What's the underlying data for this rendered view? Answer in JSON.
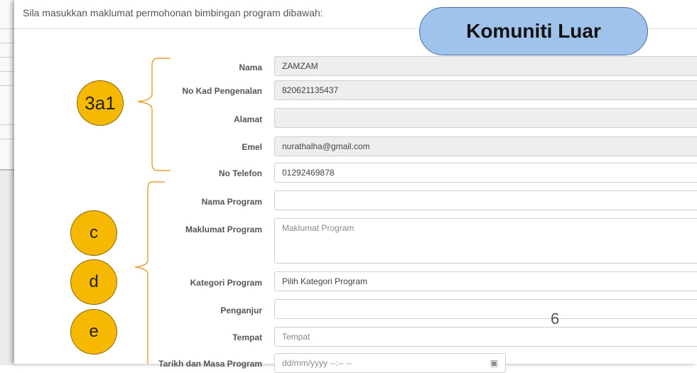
{
  "intro": "Sila masukkan maklumat permohonan bimbingan program dibawah:",
  "title_callout": "Komuniti Luar",
  "badges": {
    "b3a1": "3a1",
    "c": "c",
    "d": "d",
    "e": "e"
  },
  "page_number": "6",
  "form": {
    "nama": {
      "label": "Nama",
      "value": "ZAMZAM"
    },
    "kad": {
      "label": "No Kad Pengenalan",
      "value": "820621135437"
    },
    "alamat": {
      "label": "Alamat",
      "value": ""
    },
    "emel": {
      "label": "Emel",
      "value": "nurathalha@gmail.com"
    },
    "telefon": {
      "label": "No Telefon",
      "value": "01292469878"
    },
    "nama_program": {
      "label": "Nama Program",
      "value": ""
    },
    "maklumat_program": {
      "label": "Maklumat Program",
      "placeholder": "Maklumat Program"
    },
    "kategori_program": {
      "label": "Kategori Program",
      "value": "Pilih Kategori Program"
    },
    "penganjur": {
      "label": "Penganjur",
      "value": ""
    },
    "tempat": {
      "label": "Tempat",
      "placeholder": "Tempat"
    },
    "tarikh": {
      "label": "Tarikh dan Masa Program",
      "placeholder": "dd/mm/yyyy --:-- --"
    }
  },
  "colors": {
    "badge": "#f6b800",
    "callout": "#9fc3ea",
    "brace": "#e8a030"
  }
}
